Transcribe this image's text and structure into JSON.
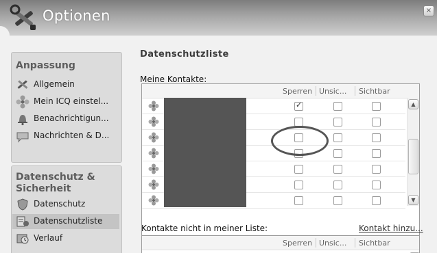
{
  "window": {
    "title": "Optionen",
    "close_glyph": "×"
  },
  "sidebar": {
    "groups": [
      {
        "title": "Anpassung",
        "items": [
          {
            "label": "Allgemein",
            "icon": "tools-icon"
          },
          {
            "label": "Mein ICQ einstel...",
            "icon": "flower-icon"
          },
          {
            "label": "Benachrichtigun...",
            "icon": "bell-icon"
          },
          {
            "label": "Nachrichten & D...",
            "icon": "message-icon"
          }
        ]
      },
      {
        "title": "Datenschutz & Sicherheit",
        "items": [
          {
            "label": "Datenschutz",
            "icon": "shield-icon"
          },
          {
            "label": "Datenschutzliste",
            "icon": "privacy-list-icon",
            "selected": true
          },
          {
            "label": "Verlauf",
            "icon": "history-icon"
          }
        ]
      }
    ]
  },
  "main": {
    "section_title": "Datenschutzliste",
    "my_contacts_label": "Meine Kontakte:",
    "columns": [
      "Sperren",
      "Unsic...",
      "Sichtbar"
    ],
    "rows": [
      {
        "sperren": true,
        "unsichtbar": false,
        "sichtbar": false
      },
      {
        "sperren": false,
        "unsichtbar": false,
        "sichtbar": false
      },
      {
        "sperren": false,
        "unsichtbar": false,
        "sichtbar": false
      },
      {
        "sperren": false,
        "unsichtbar": false,
        "sichtbar": false
      },
      {
        "sperren": false,
        "unsichtbar": false,
        "sichtbar": false
      },
      {
        "sperren": false,
        "unsichtbar": false,
        "sichtbar": false
      },
      {
        "sperren": false,
        "unsichtbar": false,
        "sichtbar": false
      }
    ],
    "not_in_list_label": "Kontakte nicht in meiner Liste:",
    "add_contact_link": "Kontakt hinzu...",
    "columns2": [
      "Sperren",
      "Unsic...",
      "Sichtbar"
    ]
  },
  "colors": {
    "title_gradient_top": "#7d7d7d",
    "title_text": "#ffffff",
    "selected_item": "#c4c4c4",
    "redaction": "#555555"
  }
}
